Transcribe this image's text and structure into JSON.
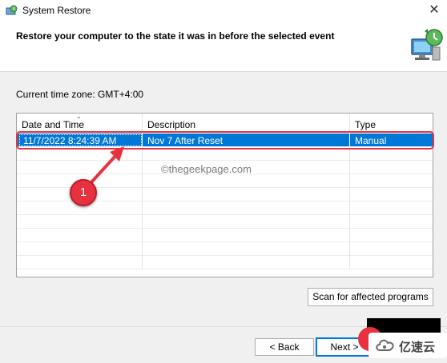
{
  "window": {
    "title": "System Restore",
    "close_glyph": "✕"
  },
  "header": {
    "text": "Restore your computer to the state it was in before the selected event"
  },
  "timezone": {
    "text": "Current time zone: GMT+4:00"
  },
  "table": {
    "columns": [
      "Date and Time",
      "Description",
      "Type"
    ],
    "rows": [
      {
        "date": "11/7/2022 8:24:39 AM",
        "description": "Nov 7 After Reset",
        "type": "Manual",
        "selected": true
      }
    ]
  },
  "watermark": "©thegeekpage.com",
  "buttons": {
    "scan": "Scan for affected programs",
    "back": "< Back",
    "next": "Next >"
  },
  "annotation": {
    "step": "1",
    "accent": "#e8313f"
  },
  "brand": {
    "text": "亿速云"
  },
  "colors": {
    "selection": "#0078d7",
    "annotation_red": "#e8313f"
  }
}
